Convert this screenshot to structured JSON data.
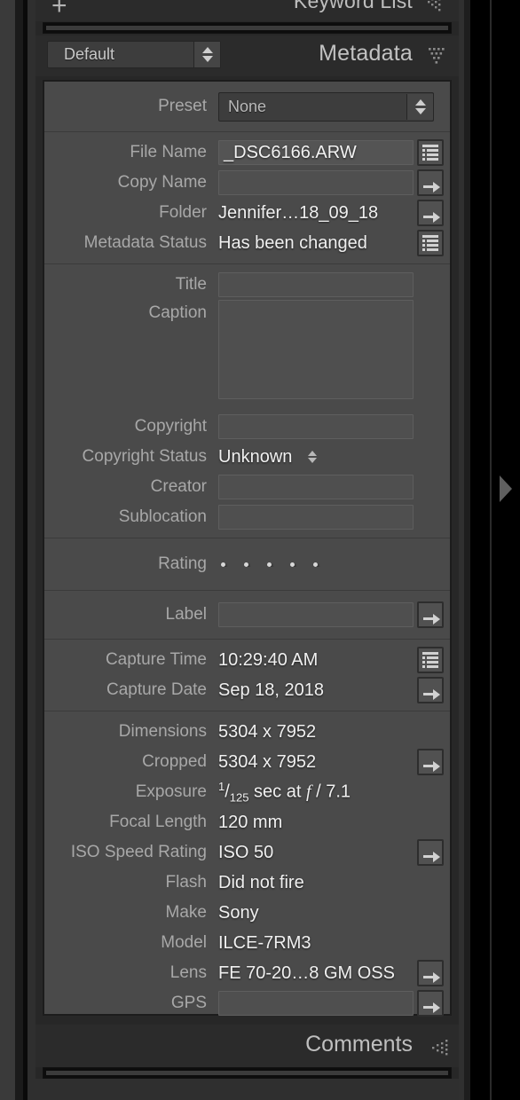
{
  "panels": {
    "keyword_list": {
      "title": "Keyword List",
      "add_label": "+",
      "icon": "dots-right-triangle-icon"
    },
    "metadata": {
      "title": "Metadata",
      "view_select_value": "Default",
      "icon": "dots-down-triangle-icon"
    },
    "comments": {
      "title": "Comments",
      "icon": "dots-left-triangle-icon"
    }
  },
  "colors": {
    "panel_bg": "#4a4a4a",
    "chrome_bg": "#272727",
    "value_text": "#f0f0f0",
    "label_text": "#a8a8a8"
  },
  "metadata": {
    "preset": {
      "label": "Preset",
      "value": "None"
    },
    "groups": [
      {
        "rows": [
          {
            "label": "File Name",
            "value": "_DSC6166.ARW",
            "field": true,
            "action": "list-icon"
          },
          {
            "label": "Copy Name",
            "value": "",
            "field": true,
            "action": "arrow-icon"
          },
          {
            "label": "Folder",
            "value": "Jennifer…18_09_18",
            "field": false,
            "action": "arrow-icon"
          },
          {
            "label": "Metadata Status",
            "value": "Has been changed",
            "field": false,
            "action": "list-icon"
          }
        ]
      },
      {
        "rows": [
          {
            "label": "Title",
            "value": "",
            "field": true,
            "action": "none"
          },
          {
            "label": "Caption",
            "value": "",
            "field": true,
            "tall": true,
            "action": "none"
          },
          {
            "label": "Copyright",
            "value": "",
            "field": true,
            "action": "none"
          },
          {
            "label": "Copyright Status",
            "value": "Unknown",
            "field": false,
            "stepper": true,
            "action": "none"
          },
          {
            "label": "Creator",
            "value": "",
            "field": true,
            "action": "none"
          },
          {
            "label": "Sublocation",
            "value": "",
            "field": true,
            "action": "none"
          }
        ]
      },
      {
        "rows": [
          {
            "label": "Rating",
            "value": "",
            "rating": 0,
            "rating_max": 5,
            "action": "none"
          }
        ]
      },
      {
        "rows": [
          {
            "label": "Label",
            "value": "",
            "field": true,
            "action": "arrow-icon"
          }
        ]
      },
      {
        "rows": [
          {
            "label": "Capture Time",
            "value": "10:29:40 AM",
            "field": false,
            "action": "list-icon"
          },
          {
            "label": "Capture Date",
            "value": "Sep 18, 2018",
            "field": false,
            "action": "arrow-icon"
          }
        ]
      },
      {
        "rows": [
          {
            "label": "Dimensions",
            "value": "5304 x 7952",
            "field": false,
            "action": "none"
          },
          {
            "label": "Cropped",
            "value": "5304 x 7952",
            "field": false,
            "action": "arrow-icon"
          },
          {
            "label": "Exposure",
            "value": "1/125 sec at f / 7.1",
            "exposure": {
              "num": "1",
              "den": "125",
              "rest": " sec at ",
              "f": "f",
              "fval": " / 7.1"
            },
            "field": false,
            "action": "none"
          },
          {
            "label": "Focal Length",
            "value": "120 mm",
            "field": false,
            "action": "none"
          },
          {
            "label": "ISO Speed Rating",
            "value": "ISO 50",
            "field": false,
            "action": "arrow-icon"
          },
          {
            "label": "Flash",
            "value": "Did not fire",
            "field": false,
            "action": "none"
          },
          {
            "label": "Make",
            "value": "Sony",
            "field": false,
            "action": "none"
          },
          {
            "label": "Model",
            "value": "ILCE-7RM3",
            "field": false,
            "action": "none"
          },
          {
            "label": "Lens",
            "value": "FE 70-20…8 GM OSS",
            "field": false,
            "action": "arrow-icon"
          },
          {
            "label": "GPS",
            "value": "",
            "field": true,
            "action": "arrow-icon"
          }
        ]
      }
    ]
  }
}
